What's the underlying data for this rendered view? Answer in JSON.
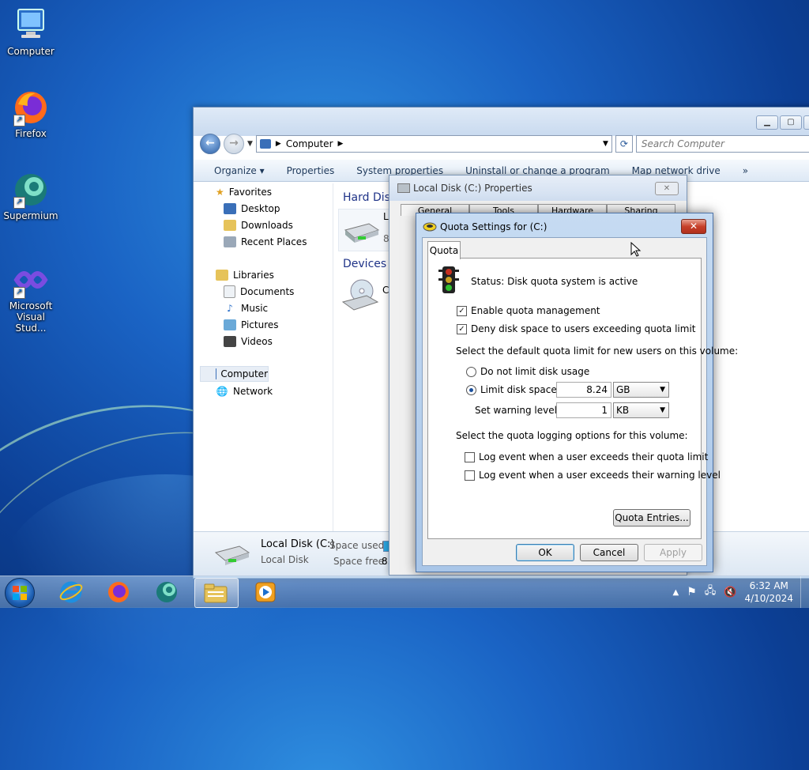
{
  "desktop": {
    "icons": [
      {
        "label": "Computer"
      },
      {
        "label": "Firefox"
      },
      {
        "label": "Supermium"
      },
      {
        "label": "Microsoft Visual Stud..."
      }
    ]
  },
  "explorer": {
    "address": "Computer",
    "search_placeholder": "Search Computer",
    "commands": [
      "Organize",
      "Properties",
      "System properties",
      "Uninstall or change a program",
      "Map network drive"
    ],
    "more": "»",
    "nav": {
      "favorites": "Favorites",
      "favorites_items": [
        "Desktop",
        "Downloads",
        "Recent Places"
      ],
      "libraries": "Libraries",
      "libraries_items": [
        "Documents",
        "Music",
        "Pictures",
        "Videos"
      ],
      "computer": "Computer",
      "network": "Network"
    },
    "content": {
      "group1": "Hard Dis",
      "drive_label_trunc": "Lo",
      "drive_size_trunc": "8.",
      "group2": "Devices w",
      "device_label_trunc": "C"
    },
    "details": {
      "name": "Local Disk (C:)",
      "type": "Local Disk",
      "space_used_label": "Space used:",
      "space_free_label": "Space free:",
      "space_free_trunc": "8."
    }
  },
  "properties": {
    "title": "Local Disk (C:) Properties",
    "tabs": [
      "General",
      "Tools",
      "Hardware",
      "Sharing"
    ]
  },
  "quota": {
    "title": "Quota Settings for  (C:)",
    "tab": "Quota",
    "status": "Status:  Disk quota system is active",
    "enable": {
      "label": "Enable quota management",
      "checked": true
    },
    "deny": {
      "label": "Deny disk space to users exceeding quota limit",
      "checked": true
    },
    "default_limit_heading": "Select the default quota limit for new users on this volume:",
    "no_limit": "Do not limit disk usage",
    "limit": "Limit disk space to",
    "limit_value": "8.24",
    "limit_unit": "GB",
    "warning": "Set warning level to",
    "warning_value": "1",
    "warning_unit": "KB",
    "logging_heading": "Select the quota logging options for this volume:",
    "log_limit": "Log event when a user exceeds their quota limit",
    "log_warning": "Log event when a user exceeds their warning level",
    "entries_button": "Quota Entries...",
    "ok": "OK",
    "cancel": "Cancel",
    "apply": "Apply"
  },
  "taskbar": {
    "time": "6:32 AM",
    "date": "4/10/2024"
  }
}
